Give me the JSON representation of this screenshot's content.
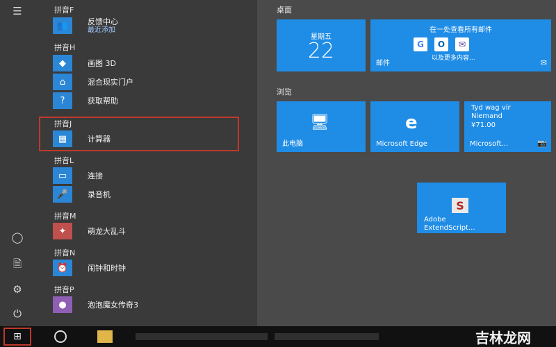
{
  "applist": {
    "sections": [
      {
        "header": "拼音F",
        "apps": [
          {
            "name": "反馈中心",
            "sub": "最近添加",
            "icon": "feedback-hub-icon"
          }
        ]
      },
      {
        "header": "拼音H",
        "apps": [
          {
            "name": "画图 3D",
            "icon": "paint3d-icon"
          },
          {
            "name": "混合现实门户",
            "icon": "mixed-reality-icon"
          },
          {
            "name": "获取帮助",
            "icon": "get-help-icon"
          }
        ]
      },
      {
        "header": "拼音J",
        "apps": [
          {
            "name": "计算器",
            "icon": "calculator-icon"
          }
        ]
      },
      {
        "header": "拼音L",
        "apps": [
          {
            "name": "连接",
            "icon": "connect-icon"
          },
          {
            "name": "录音机",
            "icon": "voice-recorder-icon"
          }
        ]
      },
      {
        "header": "拼音M",
        "apps": [
          {
            "name": "萌龙大乱斗",
            "icon": "game-icon"
          }
        ]
      },
      {
        "header": "拼音N",
        "apps": [
          {
            "name": "闹钟和时钟",
            "icon": "alarm-clock-icon"
          }
        ]
      },
      {
        "header": "拼音P",
        "apps": [
          {
            "name": "泡泡魔女传奇3",
            "icon": "bubble-game-icon"
          }
        ]
      }
    ]
  },
  "tiles": {
    "group1": "桌面",
    "group2": "浏览",
    "calendar": {
      "day": "星期五",
      "date": "22"
    },
    "mail": {
      "heading": "在一处查看所有邮件",
      "more": "以及更多内容...",
      "label": "邮件"
    },
    "this_pc": {
      "label": "此电脑"
    },
    "edge": {
      "label": "Microsoft Edge"
    },
    "store": {
      "line1": "Tyd wag vir",
      "line2": "Niemand",
      "price": "¥71.00",
      "label": "Microsoft..."
    },
    "adobe": {
      "line1": "Adobe",
      "line2": "ExtendScript..."
    }
  },
  "watermark": "吉林龙网",
  "colors": {
    "tile_blue": "#1f8ce6",
    "highlight_red": "#c0392b",
    "menu_bg": "#3a3a3a"
  }
}
